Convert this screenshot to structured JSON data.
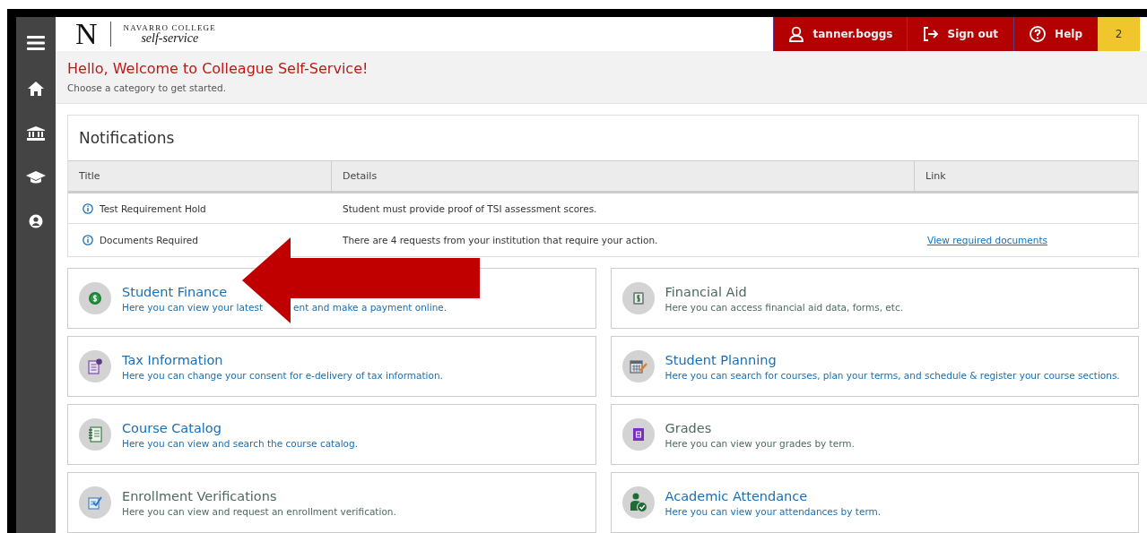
{
  "logo": {
    "letter": "N",
    "college": "NAVARRO COLLEGE",
    "tagline": "self-service"
  },
  "header_buttons": [
    {
      "kind": "user",
      "label": "tanner.boggs"
    },
    {
      "kind": "signout",
      "label": "Sign out"
    },
    {
      "kind": "help",
      "label": "Help"
    }
  ],
  "badge": "2",
  "welcome": {
    "title": "Hello, Welcome to Colleague Self-Service!",
    "subtitle": "Choose a category to get started."
  },
  "sidebar": {
    "items": [
      {
        "kind": "home"
      },
      {
        "kind": "bank"
      },
      {
        "kind": "cap"
      },
      {
        "kind": "user"
      }
    ]
  },
  "notifications": {
    "title": "Notifications",
    "columns": [
      "Title",
      "Details",
      "Link"
    ],
    "rows": [
      {
        "title": "Test Requirement Hold",
        "details": "Student must provide proof of TSI assessment scores."
      },
      {
        "title": "Documents Required",
        "details": "There are 4 requests from your institution that require your action.",
        "link": "View required documents"
      }
    ]
  },
  "cards": [
    {
      "kind": "dollar",
      "title": "Student Finance",
      "color": "#1a6fb5",
      "description": [
        "Here you can view your latest",
        "ent and make a payment online."
      ]
    },
    {
      "kind": "aid",
      "title": "Financial Aid",
      "color": "#4f6a62",
      "description": [
        "Here you can access financial aid data, forms, etc."
      ]
    },
    {
      "kind": "tax",
      "title": "Tax Information",
      "color": "#1a6fb5",
      "description": [
        "Here you can change your consent for e-delivery of tax information."
      ]
    },
    {
      "kind": "calendar",
      "title": "Student Planning",
      "color": "#1a6fb5",
      "description": [
        "Here you can search for courses, plan your terms, and schedule & register your course sections."
      ]
    },
    {
      "kind": "catalog",
      "title": "Course Catalog",
      "color": "#1a6fb5",
      "description": [
        "Here you can view and search the course catalog."
      ]
    },
    {
      "kind": "grades",
      "title": "Grades",
      "color": "#4f6a62",
      "description": [
        "Here you can view your grades by term."
      ]
    },
    {
      "kind": "verify",
      "title": "Enrollment Verifications",
      "color": "#4f6a62",
      "description": [
        "Here you can view and request an enrollment verification."
      ]
    },
    {
      "kind": "attendance",
      "title": "Academic Attendance",
      "color": "#1a6fb5",
      "description": [
        "Here you can view your attendances by term."
      ]
    }
  ]
}
